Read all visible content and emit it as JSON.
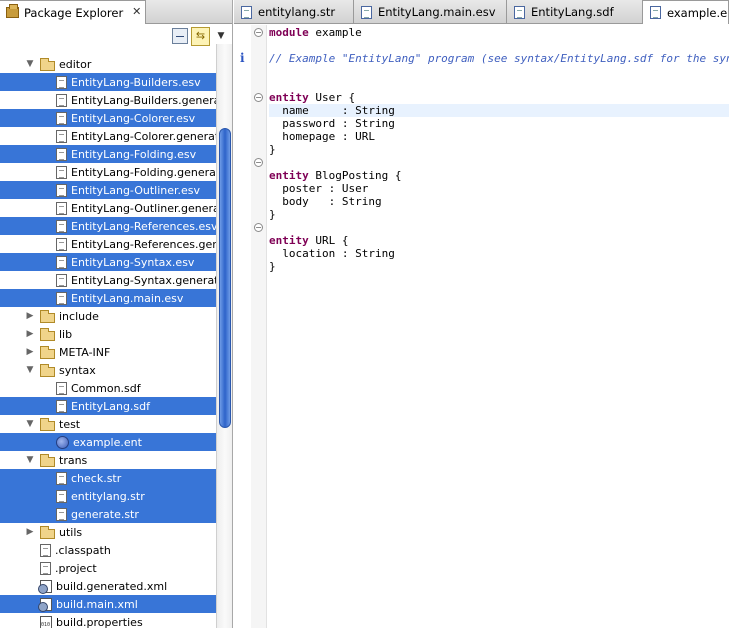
{
  "left_panel": {
    "tab_title": "Package Explorer",
    "tab_close": "✕",
    "toolbar": {
      "collapse_icon": "collapse-all-icon",
      "link_icon": "link-with-editor-icon",
      "view_menu_glyph": "▼"
    },
    "tree": [
      {
        "label": "editor",
        "kind": "folder",
        "indent": 1,
        "twisty": "open",
        "selected": false
      },
      {
        "label": "EntityLang-Builders.esv",
        "kind": "file",
        "indent": 2,
        "selected": true
      },
      {
        "label": "EntityLang-Builders.generated.esv",
        "kind": "file",
        "indent": 2,
        "selected": false
      },
      {
        "label": "EntityLang-Colorer.esv",
        "kind": "file",
        "indent": 2,
        "selected": true
      },
      {
        "label": "EntityLang-Colorer.generated.esv",
        "kind": "file",
        "indent": 2,
        "selected": false
      },
      {
        "label": "EntityLang-Folding.esv",
        "kind": "file",
        "indent": 2,
        "selected": true
      },
      {
        "label": "EntityLang-Folding.generated.esv",
        "kind": "file",
        "indent": 2,
        "selected": false
      },
      {
        "label": "EntityLang-Outliner.esv",
        "kind": "file",
        "indent": 2,
        "selected": true
      },
      {
        "label": "EntityLang-Outliner.generated.esv",
        "kind": "file",
        "indent": 2,
        "selected": false
      },
      {
        "label": "EntityLang-References.esv",
        "kind": "file",
        "indent": 2,
        "selected": true
      },
      {
        "label": "EntityLang-References.generated.esv",
        "kind": "file",
        "indent": 2,
        "selected": false
      },
      {
        "label": "EntityLang-Syntax.esv",
        "kind": "file",
        "indent": 2,
        "selected": true
      },
      {
        "label": "EntityLang-Syntax.generated.esv",
        "kind": "file",
        "indent": 2,
        "selected": false
      },
      {
        "label": "EntityLang.main.esv",
        "kind": "file",
        "indent": 2,
        "selected": true
      },
      {
        "label": "include",
        "kind": "folder",
        "indent": 1,
        "twisty": "closed",
        "selected": false
      },
      {
        "label": "lib",
        "kind": "folder",
        "indent": 1,
        "twisty": "closed",
        "selected": false
      },
      {
        "label": "META-INF",
        "kind": "folder",
        "indent": 1,
        "twisty": "closed",
        "selected": false
      },
      {
        "label": "syntax",
        "kind": "folder",
        "indent": 1,
        "twisty": "open",
        "selected": false
      },
      {
        "label": "Common.sdf",
        "kind": "file",
        "indent": 2,
        "selected": false
      },
      {
        "label": "EntityLang.sdf",
        "kind": "file",
        "indent": 2,
        "selected": true
      },
      {
        "label": "test",
        "kind": "folder",
        "indent": 1,
        "twisty": "open",
        "selected": false
      },
      {
        "label": "example.ent",
        "kind": "ent",
        "indent": 2,
        "selected": true
      },
      {
        "label": "trans",
        "kind": "folder",
        "indent": 1,
        "twisty": "open",
        "selected": false
      },
      {
        "label": "check.str",
        "kind": "file",
        "indent": 2,
        "selected": true
      },
      {
        "label": "entitylang.str",
        "kind": "file",
        "indent": 2,
        "selected": true
      },
      {
        "label": "generate.str",
        "kind": "file",
        "indent": 2,
        "selected": true
      },
      {
        "label": "utils",
        "kind": "folder",
        "indent": 1,
        "twisty": "closed",
        "selected": false
      },
      {
        "label": ".classpath",
        "kind": "file",
        "indent": 1,
        "selected": false
      },
      {
        "label": ".project",
        "kind": "file",
        "indent": 1,
        "selected": false
      },
      {
        "label": "build.generated.xml",
        "kind": "xml",
        "indent": 1,
        "selected": false
      },
      {
        "label": "build.main.xml",
        "kind": "xml",
        "indent": 1,
        "selected": true
      },
      {
        "label": "build.properties",
        "kind": "prop",
        "indent": 1,
        "selected": false
      }
    ]
  },
  "editor": {
    "tabs": [
      {
        "label": "entitylang.str",
        "active": false
      },
      {
        "label": "EntityLang.main.esv",
        "active": false
      },
      {
        "label": "EntityLang.sdf",
        "active": false
      },
      {
        "label": "example.ent",
        "active": true
      }
    ],
    "info_marker": "i",
    "fold_markers": [
      {
        "line": 0,
        "glyph": "−"
      },
      {
        "line": 5,
        "glyph": "−"
      },
      {
        "line": 10,
        "glyph": "−"
      },
      {
        "line": 15,
        "glyph": "−"
      }
    ],
    "lines": [
      {
        "parts": [
          [
            "kw",
            "module"
          ],
          [
            "tx",
            " example"
          ]
        ]
      },
      {
        "parts": []
      },
      {
        "parts": [
          [
            "cm",
            "// Example \"EntityLang\" program (see syntax/EntityLang.sdf for the syntax)"
          ]
        ]
      },
      {
        "parts": []
      },
      {
        "parts": []
      },
      {
        "parts": [
          [
            "kw",
            "entity"
          ],
          [
            "tx",
            " User {"
          ]
        ]
      },
      {
        "parts": [
          [
            "tx",
            "  name     : String"
          ]
        ],
        "highlight": true
      },
      {
        "parts": [
          [
            "tx",
            "  password : String"
          ]
        ]
      },
      {
        "parts": [
          [
            "tx",
            "  homepage : URL"
          ]
        ]
      },
      {
        "parts": [
          [
            "tx",
            "}"
          ]
        ]
      },
      {
        "parts": []
      },
      {
        "parts": [
          [
            "kw",
            "entity"
          ],
          [
            "tx",
            " BlogPosting {"
          ]
        ]
      },
      {
        "parts": [
          [
            "tx",
            "  poster : User"
          ]
        ]
      },
      {
        "parts": [
          [
            "tx",
            "  body   : String"
          ]
        ]
      },
      {
        "parts": [
          [
            "tx",
            "}"
          ]
        ]
      },
      {
        "parts": []
      },
      {
        "parts": [
          [
            "kw",
            "entity"
          ],
          [
            "tx",
            " URL {"
          ]
        ]
      },
      {
        "parts": [
          [
            "tx",
            "  location : String"
          ]
        ]
      },
      {
        "parts": [
          [
            "tx",
            "}"
          ]
        ]
      }
    ]
  }
}
